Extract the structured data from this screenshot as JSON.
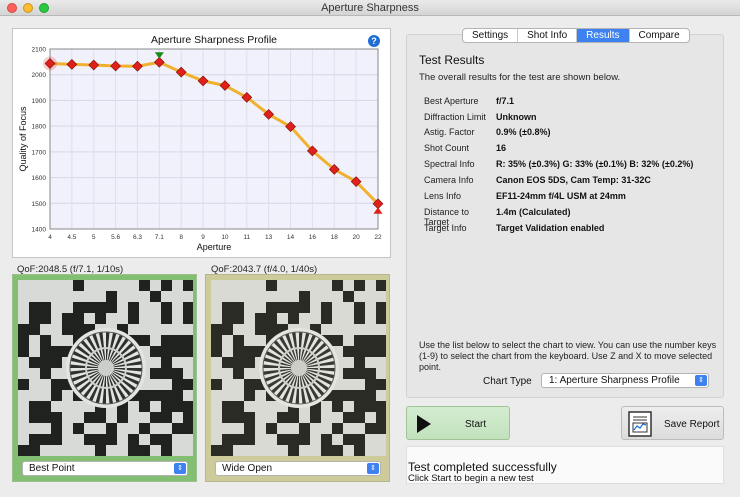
{
  "window": {
    "title": "Aperture Sharpness"
  },
  "tabs": [
    {
      "label": "Settings",
      "active": false
    },
    {
      "label": "Shot Info",
      "active": false
    },
    {
      "label": "Results",
      "active": true
    },
    {
      "label": "Compare",
      "active": false
    }
  ],
  "chart_data": {
    "type": "line",
    "title": "Aperture Sharpness Profile",
    "xlabel": "Aperture",
    "ylabel": "Quality of Focus",
    "categories": [
      "4",
      "4.5",
      "5",
      "5.6",
      "6.3",
      "7.1",
      "8",
      "9",
      "10",
      "11",
      "13",
      "14",
      "16",
      "18",
      "20",
      "22"
    ],
    "values": [
      2043.7,
      2040,
      2038,
      2034,
      2033,
      2048.5,
      2010,
      1976,
      1958,
      1912,
      1846,
      1798,
      1704,
      1632,
      1584,
      1498
    ],
    "ylim": [
      1400,
      2100
    ],
    "yticks": [
      1400,
      1500,
      1600,
      1700,
      1800,
      1900,
      2000,
      2100
    ],
    "best_index": 5,
    "worst_index": 15,
    "wide_open_index": 0,
    "line_color": "#f0b030",
    "marker_color": "#e0201a",
    "best_marker_color": "#1a8a1a",
    "worst_marker_color": "#e0201a",
    "grid": true
  },
  "images": {
    "left": {
      "caption": "QoF:2048.5 (f/7.1, 1/10s)",
      "select_value": "Best Point",
      "frame_color": "#82bf73"
    },
    "right": {
      "caption": "QoF:2043.7 (f/4.0, 1/40s)",
      "select_value": "Wide Open",
      "frame_color": "#cdcb9a"
    }
  },
  "results": {
    "heading": "Test Results",
    "subtitle": "The overall results for the test are shown below.",
    "rows": [
      {
        "key": "Best Aperture",
        "value": "f/7.1"
      },
      {
        "key": "Diffraction Limit",
        "value": "Unknown"
      },
      {
        "key": "Astig. Factor",
        "value": "0.9% (±0.8%)"
      },
      {
        "key": "Shot Count",
        "value": "16"
      },
      {
        "key": "Spectral Info",
        "value": "R: 35% (±0.3%) G: 33% (±0.1%) B: 32% (±0.2%)"
      },
      {
        "key": "Camera Info",
        "value": "Canon EOS 5DS, Cam Temp: 31-32C"
      },
      {
        "key": "Lens Info",
        "value": "EF11-24mm f/4L USM at 24mm"
      },
      {
        "key": "Distance to Target",
        "value": "1.4m (Calculated)"
      },
      {
        "key": "Target Info",
        "value": "Target Validation enabled"
      }
    ],
    "hint": "Use the list below to select the chart to view.  You can use the number keys (1-9) to select the chart from the keyboard.  Use Z and X to move selected point.",
    "chart_type_label": "Chart Type",
    "chart_type_value": "1: Aperture Sharpness Profile"
  },
  "buttons": {
    "start": "Start",
    "save_report": "Save Report"
  },
  "status": {
    "main": "Test completed successfully",
    "sub": "Click Start to begin a new test"
  },
  "colors": {
    "accent": "#3d82f0",
    "start_bg": "#c8e6c3"
  },
  "icons": {
    "help": "?",
    "popup_arrow": "⇕"
  }
}
